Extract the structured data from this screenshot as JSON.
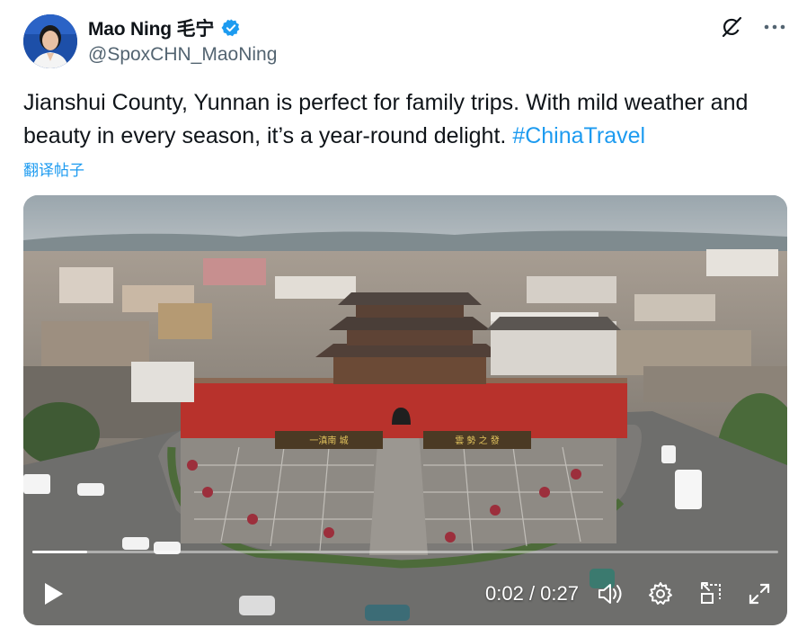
{
  "author": {
    "display_name": "Mao Ning 毛宁",
    "handle": "@SpoxCHN_MaoNing",
    "verified": true,
    "avatar_icon": "person-portrait"
  },
  "tweet": {
    "text": "Jianshui County, Yunnan is perfect for family trips. With mild weather and beauty in every season, it’s a year-round delight. ",
    "hashtag": "#ChinaTravel",
    "translate_label": "翻译帖子"
  },
  "video": {
    "current_time": "0:02",
    "separator": " / ",
    "duration": "0:27",
    "progress": 0.074,
    "gate_sign_left": "一滇南 城",
    "gate_sign_right": "雲 勢 之 發"
  },
  "icons": {
    "grok": "grok-slash-icon",
    "more": "more-dots-icon",
    "play": "play-icon",
    "volume": "volume-icon",
    "settings": "gear-icon",
    "dock": "minimize-dock-icon",
    "fullscreen": "fullscreen-icon"
  },
  "colors": {
    "link": "#1d9bf0",
    "verified": "#1d9bf0",
    "text": "#0f1419",
    "secondary": "#536471",
    "wall_red": "#b8322c"
  }
}
